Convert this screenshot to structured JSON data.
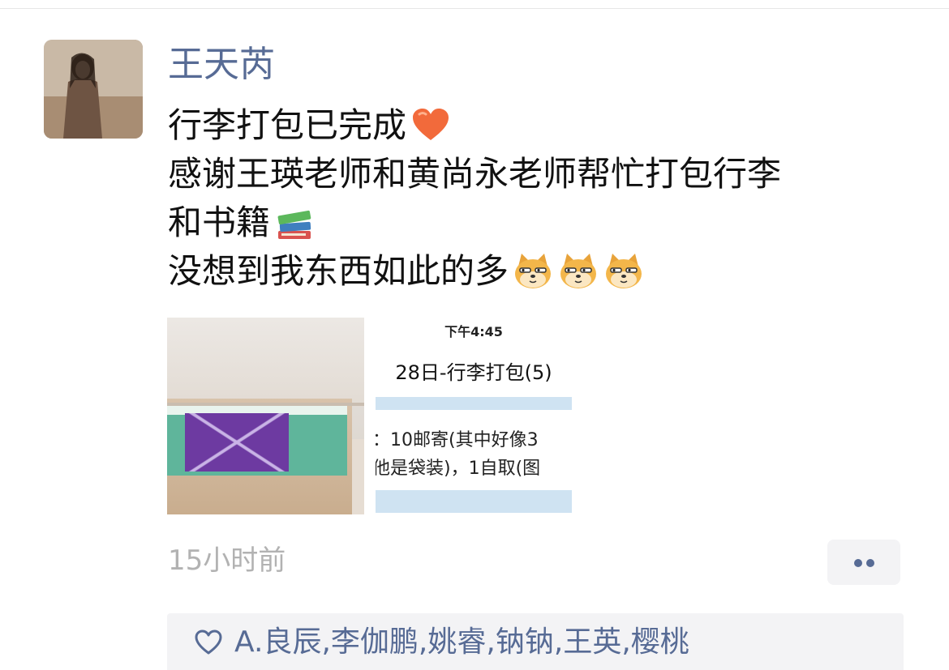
{
  "post": {
    "author": "王天芮",
    "text_lines": [
      "行李打包已完成",
      "感谢王瑛老师和黄尚永老师帮忙打包行李",
      "和书籍",
      "没想到我东西如此的多"
    ],
    "emojis": [
      "heart-emoji",
      "books-emoji",
      "doge-emoji",
      "doge-emoji",
      "doge-emoji"
    ],
    "photos": {
      "screenshot": {
        "time": "下午4:45",
        "title": "28日-行李打包(5)",
        "line1": "：10邮寄(其中好像3",
        "line2": "他是袋装)，1自取(图"
      }
    },
    "time_ago": "15小时前",
    "likes": {
      "icon": "heart-outline-icon",
      "names": [
        "A.良辰",
        "李伽鹏",
        "姚睿",
        "钠钠",
        "王英",
        "樱桃"
      ],
      "separator": ", "
    }
  },
  "colors": {
    "link": "#576b95",
    "text": "#111111",
    "meta": "#b2b2b2",
    "panel": "#f3f3f5"
  }
}
